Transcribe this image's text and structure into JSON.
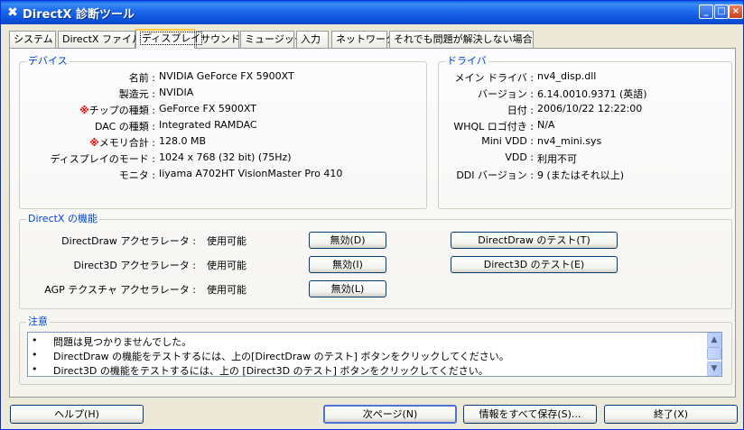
{
  "window": {
    "title": "DirectX 診断ツール",
    "icon": "directx-x-icon",
    "controls": [
      "_",
      "□",
      "×"
    ]
  },
  "tabs": [
    {
      "label": "システム",
      "active": false
    },
    {
      "label": "DirectX ファイル",
      "active": false
    },
    {
      "label": "ディスプレイ",
      "active": true
    },
    {
      "label": "サウンド",
      "active": false
    },
    {
      "label": "ミュージック",
      "active": false
    },
    {
      "label": "入力",
      "active": false
    },
    {
      "label": "ネットワーク",
      "active": false
    },
    {
      "label": "それでも問題が解決しない場合",
      "active": false
    }
  ],
  "device": {
    "title": "デバイス",
    "rows": [
      {
        "mark": "",
        "label": "名前 :",
        "value": "NVIDIA GeForce FX 5900XT"
      },
      {
        "mark": "",
        "label": "製造元 :",
        "value": "NVIDIA"
      },
      {
        "mark": "※",
        "label": "チップの種類 :",
        "value": "GeForce FX 5900XT"
      },
      {
        "mark": "",
        "label": "DAC の種類 :",
        "value": "Integrated RAMDAC"
      },
      {
        "mark": "※",
        "label": "メモリ合計 :",
        "value": "128.0 MB"
      },
      {
        "mark": "",
        "label": "ディスプレイのモード :",
        "value": "1024 x 768 (32 bit) (75Hz)"
      },
      {
        "mark": "",
        "label": "モニタ :",
        "value": "Iiyama A702HT VisionMaster Pro 410"
      }
    ]
  },
  "driver": {
    "title": "ドライバ",
    "rows": [
      {
        "label": "メイン ドライバ :",
        "value": "nv4_disp.dll"
      },
      {
        "label": "バージョン :",
        "value": "6.14.0010.9371 (英語)"
      },
      {
        "label": "日付 :",
        "value": "2006/10/22 12:22:00"
      },
      {
        "label": "WHQL ロゴ付き :",
        "value": "N/A"
      },
      {
        "label": "Mini VDD :",
        "value": "nv4_mini.sys"
      },
      {
        "label": "VDD :",
        "value": "利用不可"
      },
      {
        "label": "DDI バージョン :",
        "value": "9 (またはそれ以上)"
      }
    ]
  },
  "features": {
    "title": "DirectX の機能",
    "rows": [
      {
        "label": "DirectDraw アクセラレータ :",
        "status": "使用可能",
        "disable_label": "無効(D)",
        "test_label": "DirectDraw のテスト(T)"
      },
      {
        "label": "Direct3D アクセラレータ :",
        "status": "使用可能",
        "disable_label": "無効(I)",
        "test_label": "Direct3D のテスト(E)"
      },
      {
        "label": "AGP テクスチャ アクセラレータ :",
        "status": "使用可能",
        "disable_label": "無効(L)",
        "test_label": ""
      }
    ]
  },
  "notes": {
    "title": "注意",
    "lines": [
      "問題は見つかりませんでした。",
      "DirectDraw の機能をテストするには、上の[DirectDraw のテスト] ボタンをクリックしてください。",
      "Direct3D の機能をテストするには、上の [Direct3D のテスト] ボタンをクリックしてください。"
    ]
  },
  "bottom_buttons": {
    "help": "ヘルプ(H)",
    "next": "次ページ(N)",
    "save_all": "情報をすべて保存(S)...",
    "exit": "終了(X)"
  }
}
